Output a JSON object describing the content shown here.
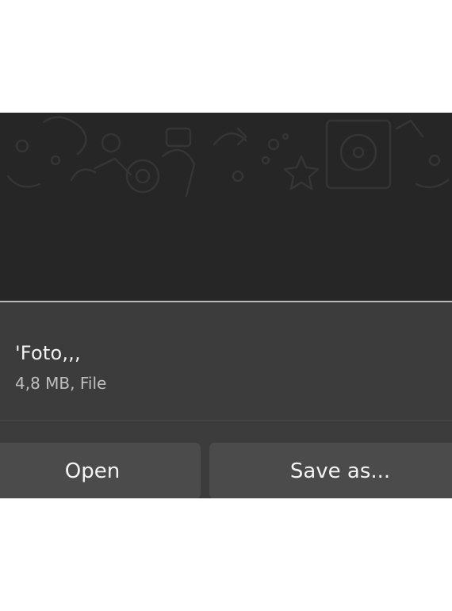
{
  "file": {
    "name": "'Foto,,,",
    "meta": "4,8 MB, File"
  },
  "actions": {
    "open_label": "Open",
    "save_as_label": "Save as..."
  },
  "colors": {
    "chat_background": "#262626",
    "card_background": "#3c3c3c",
    "button_background": "#4b4b4b",
    "accent_line": "#b9b9b9"
  }
}
